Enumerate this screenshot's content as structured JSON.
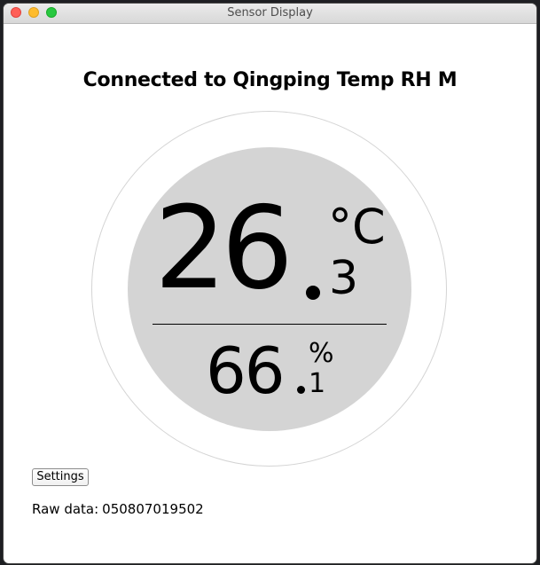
{
  "window": {
    "title": "Sensor Display"
  },
  "header": {
    "title": "Connected to Qingping Temp RH M"
  },
  "reading": {
    "temperature": {
      "integer": "26",
      "fraction": "3",
      "unit": "°C"
    },
    "humidity": {
      "integer": "66",
      "fraction": "1",
      "unit": "%"
    }
  },
  "controls": {
    "settings_label": "Settings"
  },
  "raw_data": {
    "label": "Raw data:",
    "value": "050807019502"
  },
  "colors": {
    "window_background": "#ffffff",
    "gauge_fill": "#d4d4d4",
    "gauge_ring": "#d4d4d4",
    "text": "#000000"
  }
}
